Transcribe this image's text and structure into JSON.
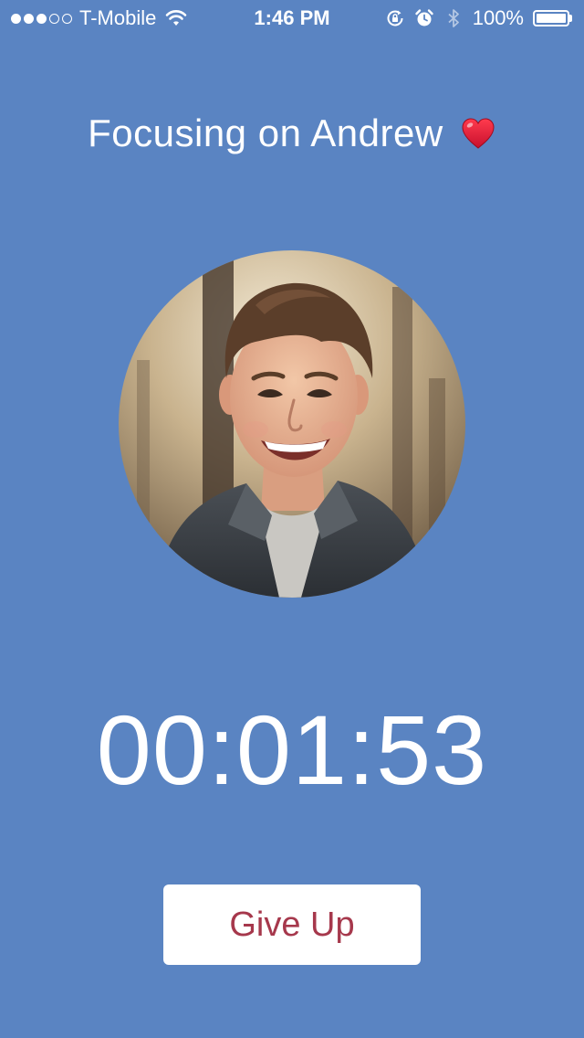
{
  "status_bar": {
    "signal_bars_filled": 3,
    "signal_bars_total": 5,
    "carrier": "T-Mobile",
    "time": "1:46 PM",
    "battery_percent": "100%",
    "battery_level": 1.0
  },
  "main": {
    "title": "Focusing on Andrew",
    "title_emoji_icon": "red-heart-icon",
    "timer": "00:01:53",
    "give_up_label": "Give Up"
  },
  "colors": {
    "background": "#5a84c2",
    "button_text": "#a6384c",
    "button_background": "#ffffff",
    "heart": "#d9162b"
  }
}
